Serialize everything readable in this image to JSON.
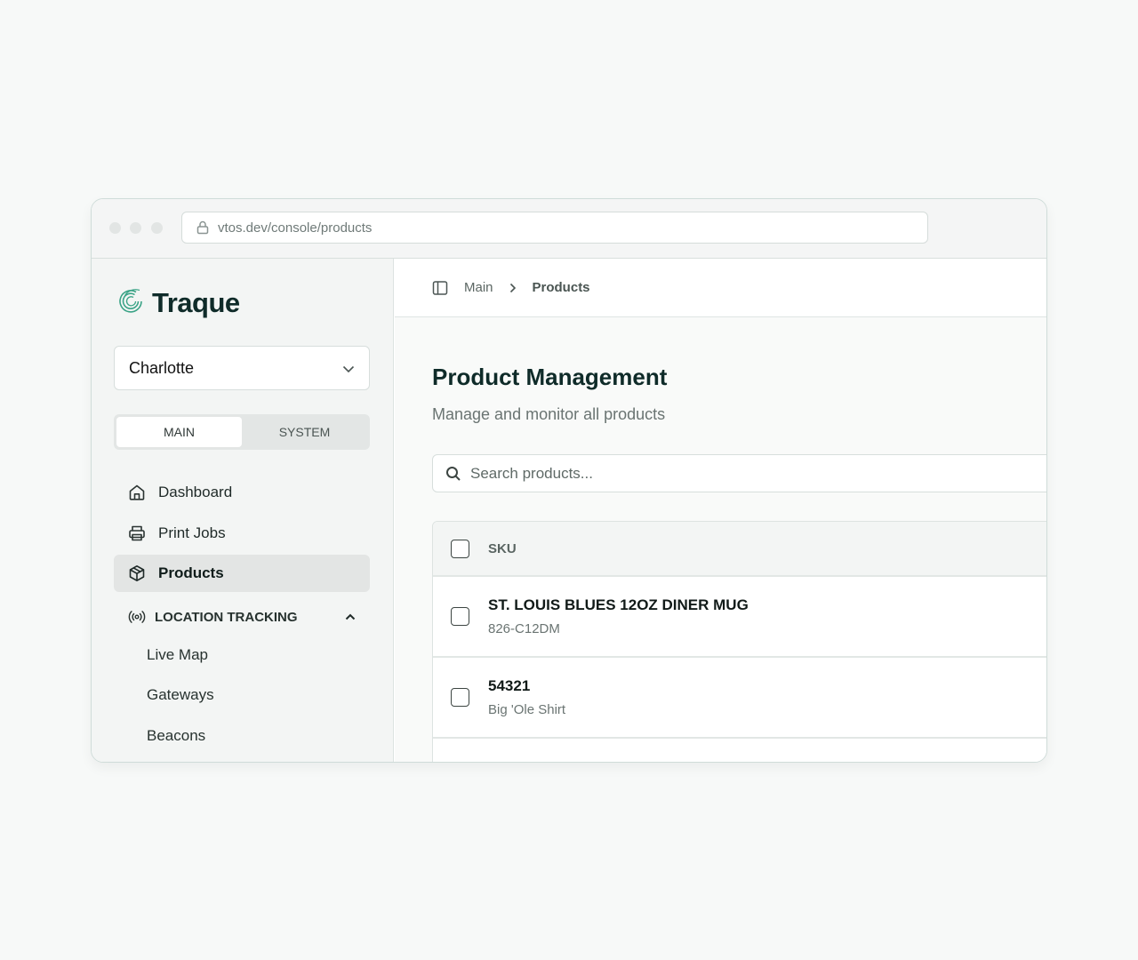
{
  "browser": {
    "url": "vtos.dev/console/products"
  },
  "sidebar": {
    "brand": "Traque",
    "org_select": {
      "value": "Charlotte"
    },
    "tabs": [
      {
        "label": "MAIN",
        "active": true
      },
      {
        "label": "SYSTEM",
        "active": false
      }
    ],
    "nav_items": [
      {
        "label": "Dashboard",
        "icon": "home-icon"
      },
      {
        "label": "Print Jobs",
        "icon": "printer-icon"
      },
      {
        "label": "Products",
        "icon": "box-icon",
        "active": true
      }
    ],
    "section": {
      "label": "LOCATION TRACKING",
      "icon": "broadcast-icon",
      "expanded": true,
      "items": [
        {
          "label": "Live Map"
        },
        {
          "label": "Gateways"
        },
        {
          "label": "Beacons"
        }
      ]
    }
  },
  "header": {
    "breadcrumb": [
      "Main",
      "Products"
    ]
  },
  "main": {
    "title": "Product Management",
    "subtitle": "Manage and monitor all products",
    "search_placeholder": "Search products...",
    "table": {
      "columns": [
        "SKU"
      ],
      "rows": [
        {
          "title": "ST. LOUIS BLUES 12OZ DINER MUG",
          "subtitle": "826-C12DM"
        },
        {
          "title": "54321",
          "subtitle": "Big 'Ole Shirt"
        }
      ]
    }
  },
  "colors": {
    "brand": "#0f2b29",
    "logo_accent": "#3aa386",
    "page_background": "#f7f9f8"
  }
}
